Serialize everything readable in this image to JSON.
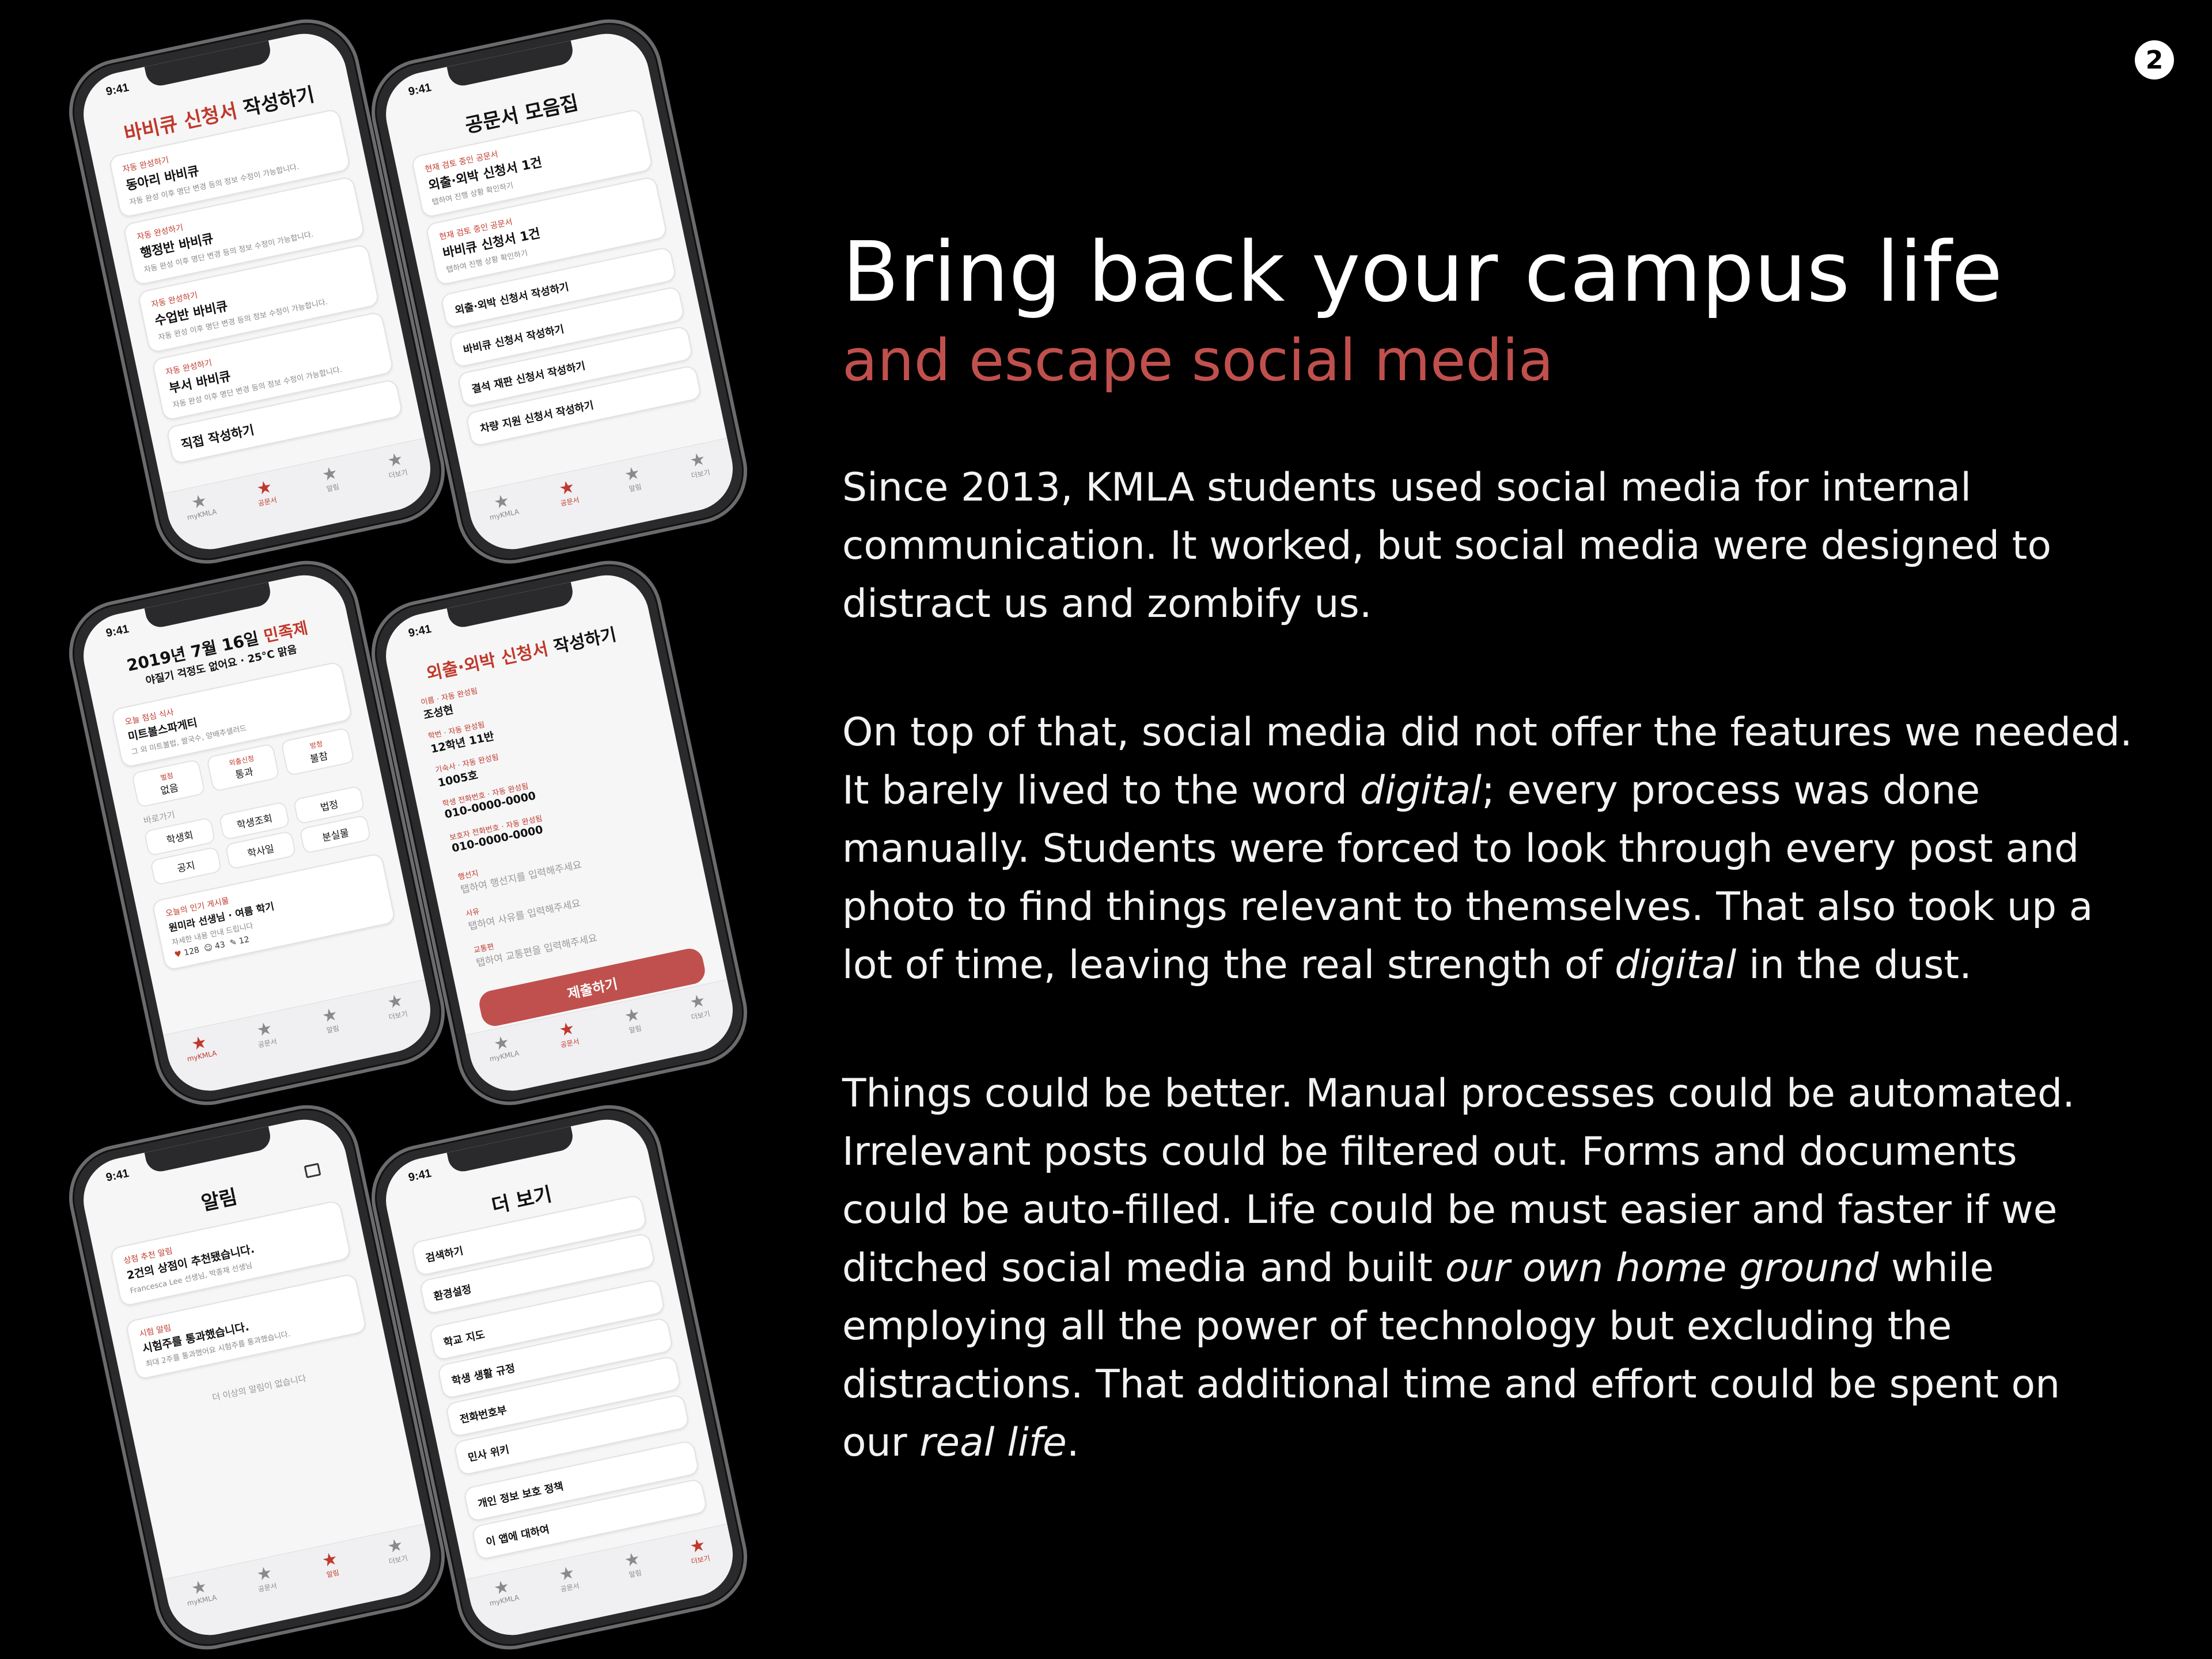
{
  "page_number": "2",
  "headline": "Bring back your campus life",
  "subheadline": "and escape social media",
  "paragraphs": {
    "p1": "Since 2013, KMLA students used social media for internal communication. It worked, but social media were designed to distract us and zombify us.",
    "p2_a": "On top of that, social media did not offer the features we needed. It barely lived to the word ",
    "p2_em1": "digital",
    "p2_b": "; every process was done manually. Students were forced to look through every post and photo to find things relevant to themselves. That also took up a lot of time, leaving the real strength of ",
    "p2_em2": "digital",
    "p2_c": " in the dust.",
    "p3_a": "Things could be better. Manual processes could be automated. Irrelevant posts could be filtered out. Forms and documents could be auto-filled. Life could be must easier and faster if we ditched social media and built ",
    "p3_em1": "our own home ground",
    "p3_b": " while employing all the power of technology but excluding the distractions. That additional time and effort could be spent on our ",
    "p3_em2": "real life",
    "p3_c": "."
  },
  "phones": {
    "time": "9:41",
    "tabs": [
      "myKMLA",
      "공문서",
      "알림",
      "더보기"
    ],
    "bbq": {
      "title_red": "바비큐 신청서",
      "title_rest": " 작성하기",
      "cards": [
        {
          "tag": "자동 완성하기",
          "title": "동아리 바비큐",
          "sub": "자동 완성 이후 명단 변경 등의 정보 수정이 가능합니다."
        },
        {
          "tag": "자동 완성하기",
          "title": "행정반 바비큐",
          "sub": "자동 완성 이후 명단 변경 등의 정보 수정이 가능합니다."
        },
        {
          "tag": "자동 완성하기",
          "title": "수업반 바비큐",
          "sub": "자동 완성 이후 명단 변경 등의 정보 수정이 가능합니다."
        },
        {
          "tag": "자동 완성하기",
          "title": "부서 바비큐",
          "sub": "자동 완성 이후 명단 변경 등의 정보 수정이 가능합니다."
        }
      ],
      "manual": "직접 작성하기"
    },
    "docs": {
      "title": "공문서 모음집",
      "cards": [
        {
          "tag": "현재 검토 중인 공문서",
          "title": "외출·외박 신청서 1건",
          "sub": "탭하여 진행 상황 확인하기"
        },
        {
          "tag": "현재 검토 중인 공문서",
          "title": "바비큐 신청서 1건",
          "sub": "탭하여 진행 상황 확인하기"
        }
      ],
      "links": [
        "외출·외박 신청서 작성하기",
        "바비큐 신청서 작성하기",
        "결석 재판 신청서 작성하기",
        "차량 지원 신청서 작성하기"
      ]
    },
    "home": {
      "date": "2019년 7월 16일 ",
      "date_red": "민족제",
      "weather": "야질기 걱정도 없어요 · 25°C 맑음",
      "meal_tag": "오늘 점심 식사",
      "meal": "미트볼스파게티",
      "meal_sub": "그 외 미트볼밥, 쌀국수, 양배추샐러드",
      "grid1": [
        {
          "l": "벌점",
          "v": "없음"
        },
        {
          "l": "외출신청",
          "v": "통과"
        },
        {
          "l": "방청",
          "v": "불참"
        }
      ],
      "grid_label": "바로가기",
      "grid2": [
        "학생회",
        "학생조회",
        "법정"
      ],
      "grid3": [
        "공지",
        "학사일",
        "분실물"
      ],
      "post_tag": "오늘의 인기 게시물",
      "post_title": "원미라 선생님 · 여름 학기",
      "post_sub": "자세한 내용 안내 드립니다",
      "stats": [
        "128",
        "43",
        "12"
      ]
    },
    "leave": {
      "title_red": "외출·외박 신청서",
      "title_rest": " 작성하기",
      "fields": [
        {
          "l": "이름 · 자동 완성됨",
          "v": "조성현"
        },
        {
          "l": "학번 · 자동 완성됨",
          "v": "12학년 11반"
        },
        {
          "l": "기숙사 · 자동 완성됨",
          "v": "1005호"
        },
        {
          "l": "학생 전화번호 · 자동 완성됨",
          "v": "010-0000-0000"
        },
        {
          "l": "보호자 전화번호 · 자동 완성됨",
          "v": "010-0000-0000"
        }
      ],
      "inputs": [
        {
          "l": "행선지",
          "p": "탭하여 행선지를 입력해주세요"
        },
        {
          "l": "사유",
          "p": "탭하여 사유를 입력해주세요"
        },
        {
          "l": "교통편",
          "p": "탭하여 교통편을 입력해주세요"
        }
      ],
      "submit": "제출하기"
    },
    "alerts": {
      "title": "알림",
      "cards": [
        {
          "tag": "상점 추천 알림",
          "title": "2건의 상점이 추천됐습니다.",
          "sub": "Francesca Lee 선생님, 박종재 선생님"
        },
        {
          "tag": "시험 알림",
          "title": "시험주를 통과했습니다.",
          "sub": "최대 2주를 통과했어요 시험주를 통과했습니다."
        }
      ],
      "empty": "더 이상의 알림이 없습니다"
    },
    "more": {
      "title": "더 보기",
      "items": [
        "검색하기",
        "환경설정",
        "학교 지도",
        "학생 생활 규정",
        "전화번호부",
        "민사 위키",
        "개인 정보 보호 정책",
        "이 앱에 대하여"
      ]
    }
  }
}
